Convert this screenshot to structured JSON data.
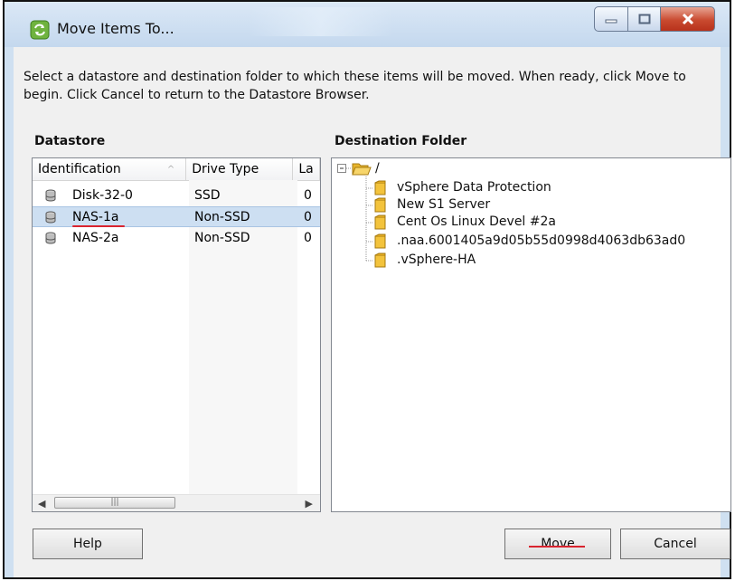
{
  "window": {
    "title": "Move Items To...",
    "icon": "refresh-arrows-icon"
  },
  "instructions": "Select a datastore and destination folder to which these items will be moved. When ready, click Move to begin. Click Cancel to return to the Datastore Browser.",
  "datastore": {
    "label": "Datastore",
    "columns": [
      "Identification",
      "Drive Type",
      "La"
    ],
    "rows": [
      {
        "identification": "Disk-32-0",
        "drive_type": "SSD",
        "extra": "0"
      },
      {
        "identification": "NAS-1a",
        "drive_type": "Non-SSD",
        "extra": "0",
        "selected": true
      },
      {
        "identification": "NAS-2a",
        "drive_type": "Non-SSD",
        "extra": "0"
      }
    ]
  },
  "destination": {
    "label": "Destination Folder",
    "root": "/",
    "folders": [
      "vSphere Data Protection",
      "New S1 Server",
      "Cent Os Linux Devel #2a",
      ".naa.6001405a9d05b55d0998d4063db63ad0",
      ".vSphere-HA"
    ]
  },
  "buttons": {
    "help": "Help",
    "move": "Move",
    "cancel": "Cancel"
  },
  "colors": {
    "selection": "#cddff2",
    "accent_underline": "#d9242f",
    "close_button": "#c94a30",
    "folder": "#f3c33c"
  }
}
